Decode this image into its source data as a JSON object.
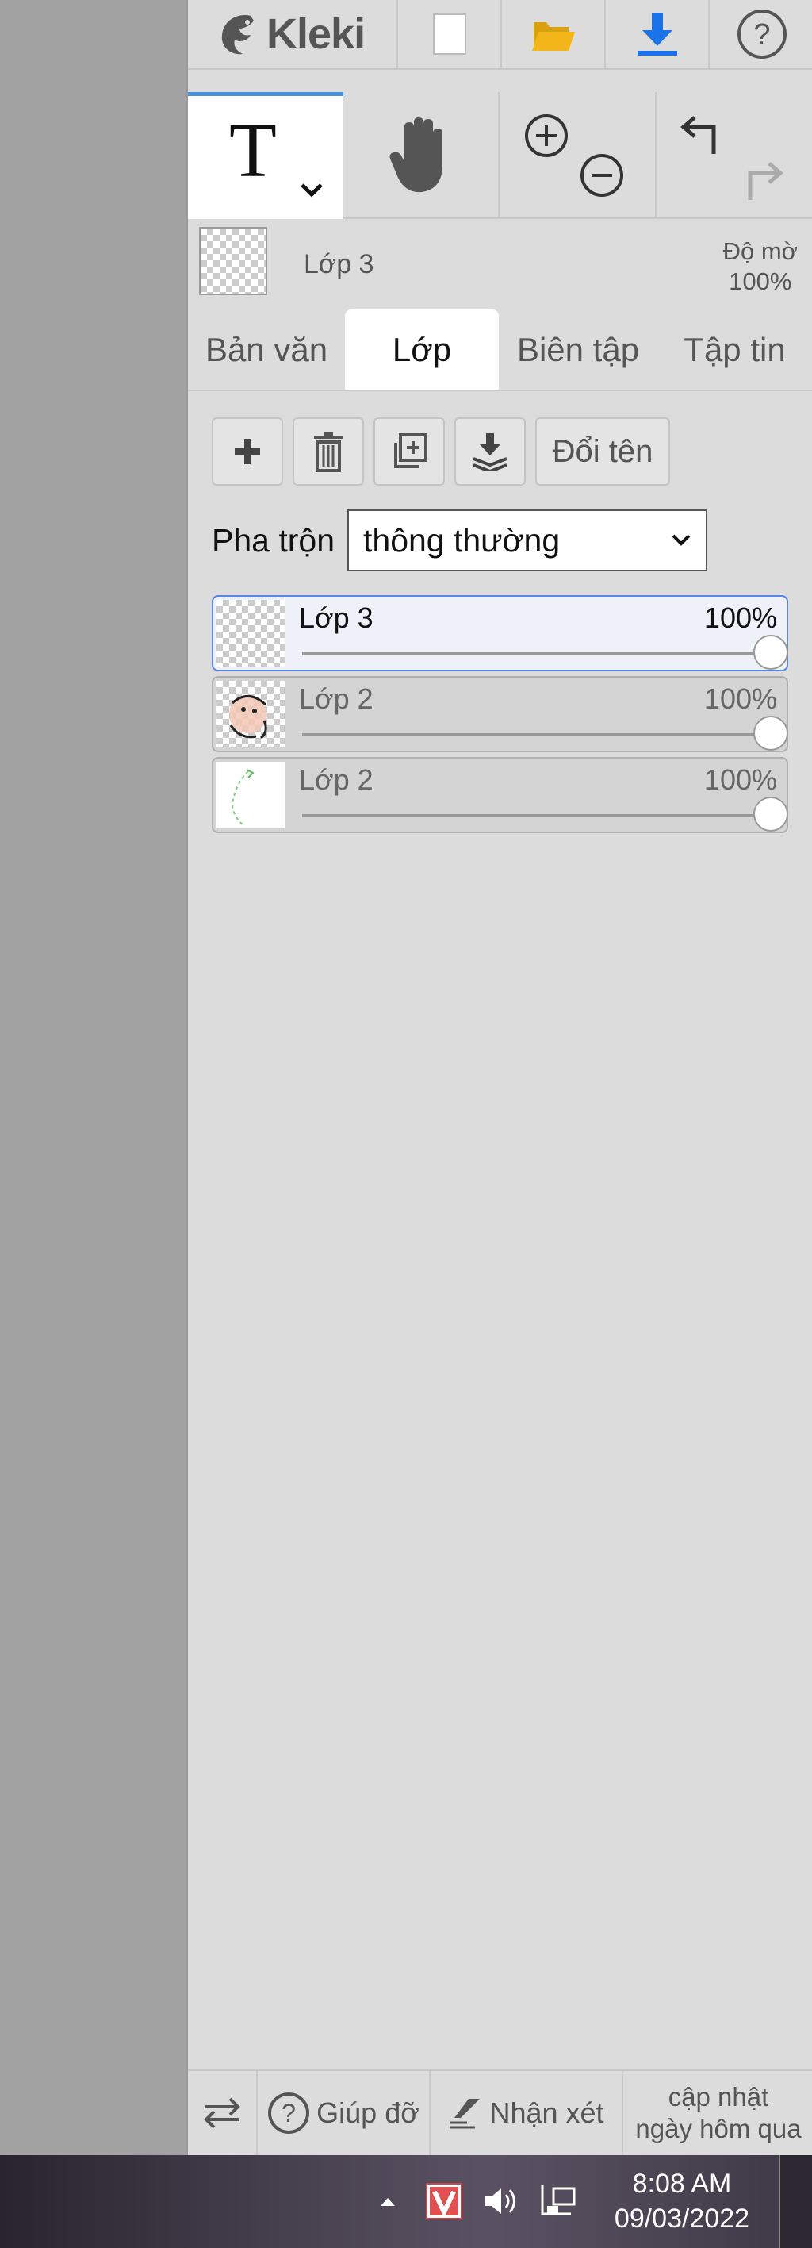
{
  "app": {
    "logo_text": "Kleki",
    "top_buttons": [
      "new-file-icon",
      "open-folder-icon",
      "download-icon",
      "help-icon"
    ]
  },
  "tools": {
    "text_tool_glyph": "T",
    "hand_tool": "hand-icon",
    "zoom_in": "zoom-in-icon",
    "zoom_out": "zoom-out-icon",
    "undo": "undo-icon",
    "redo": "redo-icon"
  },
  "current_layer": {
    "name": "Lớp 3",
    "opacity_label": "Độ mờ",
    "opacity_value": "100%"
  },
  "tabs": [
    {
      "label": "Bản văn",
      "active": false
    },
    {
      "label": "Lớp",
      "active": true
    },
    {
      "label": "Biên tập",
      "active": false
    },
    {
      "label": "Tập tin",
      "active": false
    }
  ],
  "layer_buttons": {
    "add": "plus-icon",
    "delete": "trash-icon",
    "duplicate": "duplicate-icon",
    "merge": "merge-down-icon",
    "rename_label": "Đổi tên"
  },
  "blend": {
    "label": "Pha trộn",
    "selected": "thông thường"
  },
  "layers": [
    {
      "name": "Lớp 3",
      "opacity": "100%",
      "opacity_value": 1.0,
      "selected": true
    },
    {
      "name": "Lớp 2",
      "opacity": "100%",
      "opacity_value": 1.0,
      "selected": false
    },
    {
      "name": "Lớp 2",
      "opacity": "100%",
      "opacity_value": 1.0,
      "selected": false
    }
  ],
  "bottom_bar": {
    "help_label": "Giúp đỡ",
    "feedback_label": "Nhận xét",
    "update_line1": "cập nhật",
    "update_line2": "ngày hôm qua"
  },
  "taskbar": {
    "time": "8:08 AM",
    "date": "09/03/2022"
  },
  "colors": {
    "accent": "#4a90e2",
    "panel_bg": "#dcdcdc",
    "download_blue": "#1a73e8",
    "folder_yellow": "#f2b61b"
  }
}
